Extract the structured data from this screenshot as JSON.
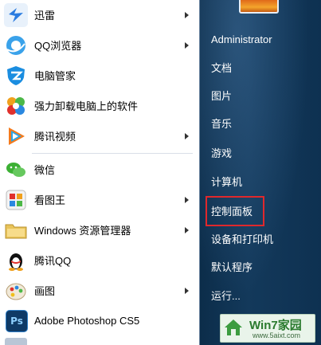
{
  "left_menu": {
    "items": [
      {
        "label": "迅雷",
        "icon": "xunlei-icon",
        "has_submenu": true
      },
      {
        "label": "QQ浏览器",
        "icon": "qq-browser-icon",
        "has_submenu": true
      },
      {
        "label": "电脑管家",
        "icon": "pc-manager-icon",
        "has_submenu": false
      },
      {
        "label": "强力卸载电脑上的软件",
        "icon": "uninstall-icon",
        "has_submenu": false
      },
      {
        "label": "腾讯视频",
        "icon": "tencent-video-icon",
        "has_submenu": true
      },
      {
        "label": "微信",
        "icon": "wechat-icon",
        "has_submenu": false
      },
      {
        "label": "看图王",
        "icon": "image-viewer-icon",
        "has_submenu": true
      },
      {
        "label": "Windows 资源管理器",
        "icon": "explorer-folder-icon",
        "has_submenu": true
      },
      {
        "label": "腾讯QQ",
        "icon": "qq-penguin-icon",
        "has_submenu": false
      },
      {
        "label": "画图",
        "icon": "paint-icon",
        "has_submenu": true
      },
      {
        "label": "Adobe Photoshop CS5",
        "icon": "photoshop-icon",
        "has_submenu": false
      }
    ]
  },
  "right_menu": {
    "user": "Administrator",
    "items": [
      "文档",
      "图片",
      "音乐",
      "游戏",
      "计算机",
      "控制面板",
      "设备和打印机",
      "默认程序",
      "运行..."
    ],
    "highlighted": "控制面板",
    "highlight_color": "#e0282c"
  },
  "watermark": {
    "title": "Win7家园",
    "url": "www.5aixt.com"
  },
  "colors": {
    "right_pane": "#13395b",
    "separator": "#d9dfe8"
  }
}
